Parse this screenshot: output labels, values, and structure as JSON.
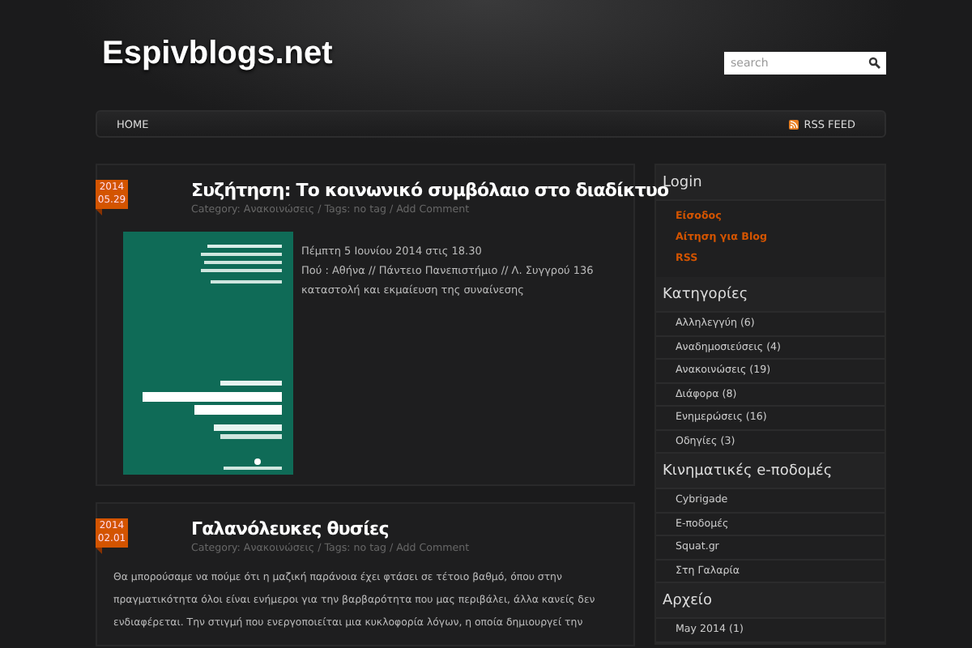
{
  "header": {
    "site_title": "Espivblogs.net",
    "search": {
      "placeholder": "search"
    }
  },
  "nav": {
    "items": [
      {
        "label": "HOME"
      }
    ],
    "rss": "RSS FEED"
  },
  "posts": [
    {
      "date_year": "2014",
      "date_day": "05.29",
      "title": "Συζήτηση: Το κοινωνικό συμβόλαιο στο διαδίκτυο",
      "meta": "Category: Ανακοινώσεις / Tags: no tag / Add Comment",
      "image": {
        "kind": "picture"
      },
      "body": [
        "Πέμπτη 5 Ιουνίου 2014 στις 18.30",
        "Πού : Αθήνα // Πάντειο Πανεπιστήμιο // Λ. Συγγρού 136",
        "καταστολή και εκμαίευση της συναίνεσης"
      ]
    },
    {
      "date_year": "2014",
      "date_day": "02.01",
      "title": "Γαλανόλευκες θυσίες",
      "meta": "Category: Ανακοινώσεις / Tags: no tag / Add Comment",
      "body": [
        "Θα μπορούσαμε να πούμε ότι η μαζική παράνοια έχει φτάσει σε τέτοιο βαθμό, όπου στην",
        "πραγματικότητα όλοι είναι ενήμεροι για την βαρβαρότητα που μας περιβάλει, άλλα κανείς δεν",
        "ενδιαφέρεται. Την στιγμή που ενεργοποιείται μια κυκλοφορία λόγων, η οποία δημιουργεί την"
      ]
    }
  ],
  "sidebar": [
    {
      "title": "Login",
      "kind": "links",
      "items": [
        "Είσοδος",
        "Αίτηση για Blog",
        "RSS"
      ]
    },
    {
      "title": "Κατηγορίες",
      "kind": "list",
      "items": [
        "Αλληλεγγύη (6)",
        "Αναδημοσιεύσεις (4)",
        "Ανακοινώσεις (19)",
        "Διάφορα (8)",
        "Ενημερώσεις (16)",
        "Οδηγίες (3)"
      ]
    },
    {
      "title": "Κινηματικές e-ποδομές",
      "kind": "list",
      "items": [
        "Cybrigade",
        "E-ποδομές",
        "Squat.gr",
        "Στη Γαλαρία"
      ]
    },
    {
      "title": "Αρχείο",
      "kind": "list",
      "items": [
        "May 2014 (1)"
      ]
    }
  ]
}
